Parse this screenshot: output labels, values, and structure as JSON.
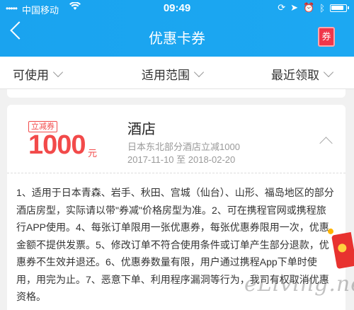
{
  "status_bar": {
    "signal": "•••••",
    "carrier": "中国移动",
    "wifi_icon": "wifi-icon",
    "time": "09:49",
    "icons": [
      "lock-rotation-icon",
      "location-icon",
      "alarm-icon",
      "bluetooth-icon",
      "battery-icon"
    ]
  },
  "nav": {
    "title": "优惠卡券",
    "ticket_label": "券",
    "back_icon": "chevron-left-icon"
  },
  "filters": [
    {
      "label": "可使用"
    },
    {
      "label": "适用范围"
    },
    {
      "label": "最近领取"
    }
  ],
  "coupon": {
    "badge": "立减券",
    "amount": "1000",
    "unit": "元",
    "title": "酒店",
    "description": "日本东北部分酒店立减1000",
    "date_range": "2017-11-10 至 2018-02-20",
    "terms": "1、适用于日本青森、岩手、秋田、宫城（仙台）、山形、福岛地区的部分酒店房型，实际请以带\"券减\"价格房型为准。2、可在携程官网或携程旅行APP使用。4、每张订单限用一张优惠券，每张优惠券限用一次，优惠金额不提供发票。5、修改订单不符合使用条件或订单产生部分退款，优惠券不生效并退还。6、优惠券数量有限，用户通过携程App下单时使用，用完为止。7、恶意下单、利用程序漏洞等行为，我司有权取消优惠资格。"
  },
  "watermark": "eLiving.net",
  "colors": {
    "brand_blue": "#1ca8f2",
    "accent_red": "#f24a4a"
  }
}
